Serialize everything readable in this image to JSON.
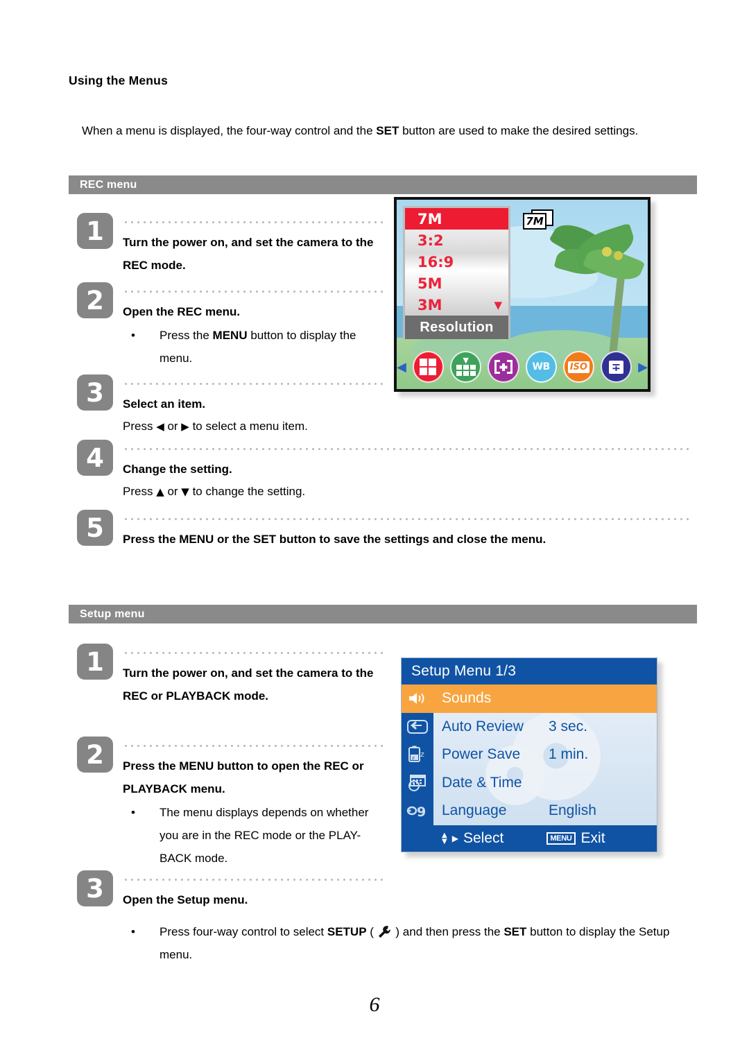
{
  "document": {
    "section_title": "Using the Menus",
    "intro_pre": "When a menu is displayed, the four-way control and the ",
    "intro_bold": "SET",
    "intro_post": " button are used to make the desired settings.",
    "page_number": "6"
  },
  "rec_section": {
    "bar_label": "REC menu",
    "steps": [
      {
        "num": "1",
        "title": "Turn the power on, and set the camera to the REC mode."
      },
      {
        "num": "2",
        "title": "Open the REC menu.",
        "bullet_pre": "Press the ",
        "bullet_bold": "MENU",
        "bullet_post": " button to display the menu."
      },
      {
        "num": "3",
        "title": "Select an item.",
        "detail_pre": "Press ",
        "detail_left": "◀",
        "detail_mid": " or ",
        "detail_right": "▶",
        "detail_post": " to select a menu item."
      },
      {
        "num": "4",
        "title": "Change the setting.",
        "detail_pre": "Press ",
        "detail_up": "▲",
        "detail_mid": " or ",
        "detail_down": "▼",
        "detail_post": " to change the setting."
      },
      {
        "num": "5",
        "title": "Press the MENU or the SET button to save the settings and close the menu."
      }
    ]
  },
  "rec_lcd": {
    "badge": "7M",
    "options": [
      {
        "label": "7M",
        "selected": true
      },
      {
        "label": "3:2",
        "selected": false
      },
      {
        "label": "16:9",
        "selected": false
      },
      {
        "label": "5M",
        "selected": false
      },
      {
        "label": "3M",
        "selected": false
      }
    ],
    "scroll_down_indicator": "▼",
    "menu_label": "Resolution",
    "nav_left": "◀",
    "nav_right": "▶",
    "icons": [
      {
        "name": "resolution-icon",
        "color": "#ec1d33"
      },
      {
        "name": "quality-icon",
        "color": "#3fa25b"
      },
      {
        "name": "focus-area-icon",
        "color": "#9b2f9b"
      },
      {
        "name": "white-balance-icon",
        "label": "WB",
        "color": "#53bde6"
      },
      {
        "name": "iso-icon",
        "label": "ISO",
        "color": "#f07c1c"
      },
      {
        "name": "exposure-icon",
        "color": "#2e3192"
      }
    ]
  },
  "setup_section": {
    "bar_label": "Setup menu",
    "steps": [
      {
        "num": "1",
        "title": "Turn the power on, and set the camera to the REC or PLAYBACK mode."
      },
      {
        "num": "2",
        "title": "Press the MENU button to open the REC or PLAYBACK menu.",
        "bullet": "The menu displays depends on whether you are in the REC mode or the PLAY- BACK mode."
      },
      {
        "num": "3",
        "title": "Open the Setup menu.",
        "b_pre": "Press four-way control to select ",
        "b_bold1": "SETUP",
        "b_paren_open": " ( ",
        "b_paren_close": " ) and then press the ",
        "b_bold2": "SET",
        "b_post": " button to display the Setup menu."
      }
    ]
  },
  "setup_lcd": {
    "title": "Setup Menu 1/3",
    "rows": [
      {
        "label": "Sounds",
        "value": "",
        "icon": "speaker-icon",
        "selected": true
      },
      {
        "label": "Auto Review",
        "value": "3 sec.",
        "icon": "review-icon",
        "selected": false
      },
      {
        "label": "Power Save",
        "value": "1 min.",
        "icon": "power-save-icon",
        "selected": false
      },
      {
        "label": "Date & Time",
        "value": "",
        "icon": "calendar-clock-icon",
        "selected": false
      },
      {
        "label": "Language",
        "value": "English",
        "icon": "language-icon",
        "selected": false
      }
    ],
    "footer_select": "Select",
    "footer_menu_chip": "MENU",
    "footer_exit": "Exit"
  },
  "colors": {
    "bar_gray": "#8a8a8a",
    "badge_gray": "#858585",
    "lcd_blue": "#1053a4",
    "highlight_orange": "#f8a541",
    "selection_red": "#ed1c32"
  }
}
